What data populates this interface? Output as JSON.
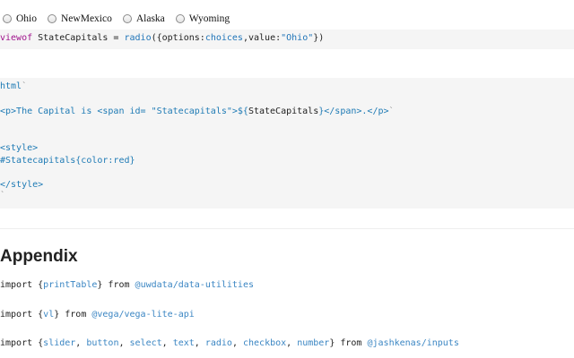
{
  "radio_input": {
    "options": [
      "Ohio",
      "NewMexico",
      "Alaska",
      "Wyoming"
    ],
    "selected": "Ohio"
  },
  "cell_viewof": {
    "keyword": "viewof",
    "text1": " StateCapitals = ",
    "fn": "radio",
    "text2": "({options:",
    "var": "choices",
    "text3": ",value:",
    "value": "\"Ohio\"",
    "text4": "})"
  },
  "cell_html": {
    "line1_code": "html",
    "line1_tick": "`",
    "line2_code": "<p>The Capital is <span id= \"Statecapitals\">${",
    "line2_var": "StateCapitals",
    "line2_code_end": "}</span>.</p>",
    "line2_tick": "`",
    "line3": "<style>",
    "line4": "#Statecapitals{color:red}",
    "line5": "</style>",
    "line6": "`"
  },
  "appendix": {
    "title": "Appendix",
    "imports": [
      {
        "pre": "import {",
        "names": [
          "printTable"
        ],
        "post": "} from ",
        "source": "@uwdata/data-utilities"
      },
      {
        "pre": "import {",
        "names": [
          "vl"
        ],
        "post": "} from ",
        "source": "@vega/vega-lite-api"
      },
      {
        "pre": "import {",
        "names": [
          "slider",
          "button",
          "select",
          "text",
          "radio",
          "checkbox",
          "number"
        ],
        "post": "} from ",
        "source": "@jashkenas/inputs"
      }
    ],
    "separator": ", "
  }
}
